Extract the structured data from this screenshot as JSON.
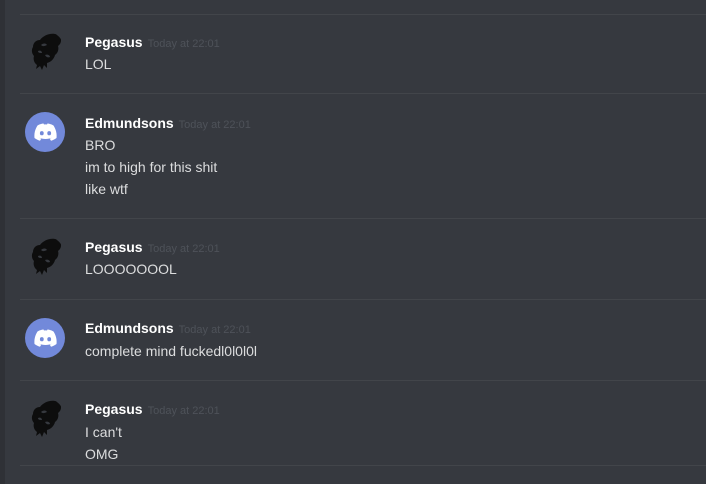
{
  "messages": [
    {
      "author": "Pegasus",
      "avatar_icon": "pegasus-logo-icon",
      "timestamp": "Today at 22:01",
      "lines": [
        "LOL"
      ]
    },
    {
      "author": "Edmundsons",
      "avatar_icon": "discord-default-avatar-icon",
      "timestamp": "Today at 22:01",
      "lines": [
        "BRO",
        "im to high for this shit",
        "like wtf"
      ]
    },
    {
      "author": "Pegasus",
      "avatar_icon": "pegasus-logo-icon",
      "timestamp": "Today at 22:01",
      "lines": [
        "LOOOOOOOL"
      ]
    },
    {
      "author": "Edmundsons",
      "avatar_icon": "discord-default-avatar-icon",
      "timestamp": "Today at 22:01",
      "lines": [
        "complete mind fuckedl0l0l0l"
      ]
    },
    {
      "author": "Pegasus",
      "avatar_icon": "pegasus-logo-icon",
      "timestamp": "Today at 22:01",
      "lines": [
        "I can't",
        "OMG"
      ]
    }
  ],
  "colors": {
    "background": "#36393f",
    "username": "#ffffff",
    "message_text": "#dcddde",
    "timestamp": "#4e5259",
    "divider": "#42454a",
    "discord_blurple": "#7289da"
  }
}
